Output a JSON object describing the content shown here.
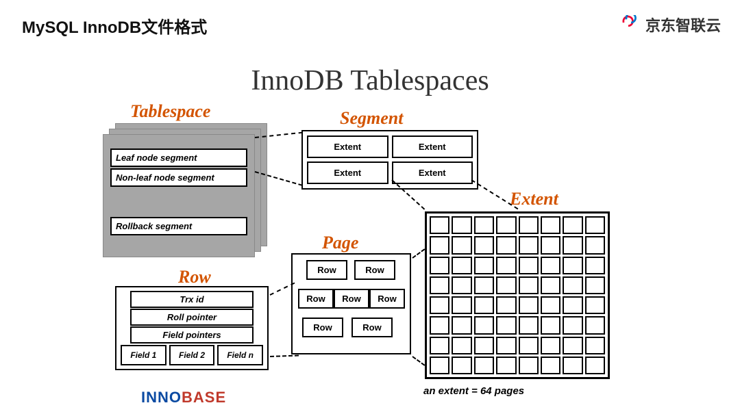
{
  "page_title": "MySQL InnoDB文件格式",
  "brand": "京东智联云",
  "main_title": "InnoDB Tablespaces",
  "labels": {
    "tablespace": "Tablespace",
    "segment": "Segment",
    "extent": "Extent",
    "page": "Page",
    "row": "Row"
  },
  "tablespace_items": [
    "Leaf node segment",
    "Non-leaf node segment",
    "Rollback segment"
  ],
  "segment_cells": [
    "Extent",
    "Extent",
    "Extent",
    "Extent"
  ],
  "extent_note": "an extent = 64 pages",
  "page_rows": [
    "Row",
    "Row",
    "Row",
    "Row",
    "Row",
    "Row",
    "Row"
  ],
  "row_box": {
    "lines": [
      "Trx id",
      "Roll pointer",
      "Field pointers"
    ],
    "fields": [
      "Field 1",
      "Field 2",
      "Field n"
    ]
  },
  "innobase": {
    "a": "INNO",
    "b": "BASE"
  },
  "chart_data": {
    "type": "diagram",
    "hierarchy": [
      "Tablespace",
      "Segment",
      "Extent",
      "Page",
      "Row"
    ],
    "tablespace_contains": [
      "Leaf node segment",
      "Non-leaf node segment",
      "Rollback segment"
    ],
    "segment_contains": "Extents",
    "extent_contains_pages": 64,
    "page_contains": "Rows",
    "row_fields": [
      "Trx id",
      "Roll pointer",
      "Field pointers",
      "Field 1",
      "Field 2",
      "Field n"
    ]
  }
}
